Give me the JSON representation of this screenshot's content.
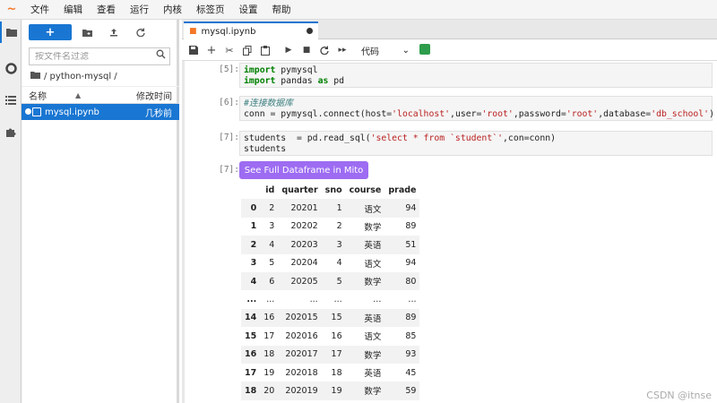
{
  "menubar": {
    "logo": "~",
    "items": [
      "文件",
      "编辑",
      "查看",
      "运行",
      "内核",
      "标签页",
      "设置",
      "帮助"
    ]
  },
  "filebrowser": {
    "new_label": "+",
    "filter_placeholder": "按文件名过滤",
    "breadcrumb": "/ python-mysql /",
    "col_name": "名称",
    "col_modified": "修改时间",
    "files": [
      {
        "name": "mysql.ipynb",
        "modified": "几秒前"
      }
    ]
  },
  "tab": {
    "label": "mysql.ipynb"
  },
  "toolbar": {
    "cell_type": "代码"
  },
  "cells": [
    {
      "prompt": "[5]:"
    },
    {
      "prompt": "[6]:"
    },
    {
      "prompt": "[7]:"
    },
    {
      "prompt": "[7]:"
    }
  ],
  "mito_button": "See Full Dataframe in Mito",
  "dataframe": {
    "columns": [
      "id",
      "quarter",
      "sno",
      "course",
      "prade"
    ],
    "rows": [
      {
        "idx": "0",
        "cells": [
          "2",
          "20201",
          "1",
          "语文",
          "94"
        ]
      },
      {
        "idx": "1",
        "cells": [
          "3",
          "20202",
          "2",
          "数学",
          "89"
        ]
      },
      {
        "idx": "2",
        "cells": [
          "4",
          "20203",
          "3",
          "英语",
          "51"
        ]
      },
      {
        "idx": "3",
        "cells": [
          "5",
          "20204",
          "4",
          "语文",
          "94"
        ]
      },
      {
        "idx": "4",
        "cells": [
          "6",
          "20205",
          "5",
          "数学",
          "80"
        ]
      },
      {
        "idx": "...",
        "cells": [
          "...",
          "...",
          "...",
          "...",
          "..."
        ]
      },
      {
        "idx": "14",
        "cells": [
          "16",
          "202015",
          "15",
          "英语",
          "89"
        ]
      },
      {
        "idx": "15",
        "cells": [
          "17",
          "202016",
          "16",
          "语文",
          "85"
        ]
      },
      {
        "idx": "16",
        "cells": [
          "18",
          "202017",
          "17",
          "数学",
          "93"
        ]
      },
      {
        "idx": "17",
        "cells": [
          "19",
          "202018",
          "18",
          "英语",
          "45"
        ]
      },
      {
        "idx": "18",
        "cells": [
          "20",
          "202019",
          "19",
          "数学",
          "59"
        ]
      }
    ]
  },
  "watermark": "CSDN @itnse",
  "colors": {
    "accent": "#1976d2",
    "mito": "#9d6cf2",
    "logo": "#f37726"
  }
}
